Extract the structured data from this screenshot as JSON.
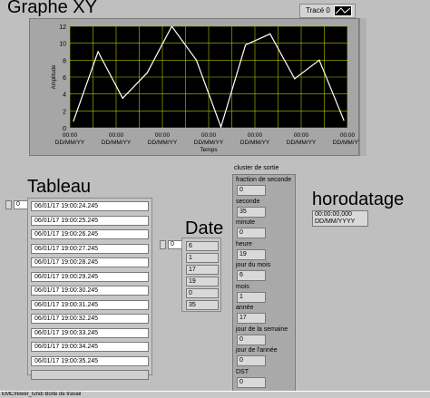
{
  "graph": {
    "title": "Graphe XY",
    "legend_label": "Tracé 0",
    "x_axis_label": "Temps",
    "y_axis_label": "Amplitude",
    "x_tick_time": "00:00",
    "x_tick_date": "DD/MM/YY",
    "plot_bg_color": "#000000",
    "grid_color": "#b5c400",
    "line_color": "#ffffff",
    "y_ticks": [
      "0",
      "2",
      "4",
      "6",
      "8",
      "10",
      "12"
    ]
  },
  "chart_data": {
    "type": "line",
    "xlabel": "Temps",
    "ylabel": "Amplitude",
    "ylim": [
      0,
      12
    ],
    "x": [
      0,
      1,
      2,
      3,
      4,
      5,
      6,
      7,
      8,
      9,
      10,
      11
    ],
    "series": [
      {
        "name": "Tracé 0",
        "values": [
          0.8,
          9,
          3.5,
          6.5,
          12,
          8,
          0.1,
          9.8,
          11.1,
          5.8,
          8,
          0.9
        ]
      }
    ],
    "grid": true,
    "legend": "top-right"
  },
  "table": {
    "title": "Tableau",
    "index": "0",
    "rows": [
      "06/01/17 19:00:24.245",
      "06/01/17 19:00:25.245",
      "06/01/17 19:00:26.245",
      "06/01/17 19:00:27.245",
      "06/01/17 19:00:28.245",
      "06/01/17 19:00:29.245",
      "06/01/17 19:00:30.245",
      "06/01/17 19:00:31.245",
      "06/01/17 19:00:32.245",
      "06/01/17 19:00:33.245",
      "06/01/17 19:00:34.245",
      "06/01/17 19:00:35.245"
    ]
  },
  "date": {
    "title": "Date",
    "index": "0",
    "values": [
      "6",
      "1",
      "17",
      "19",
      "0",
      "35"
    ]
  },
  "cluster": {
    "label": "cluster de sortie",
    "fields": [
      {
        "label": "fraction de seconde",
        "value": "0"
      },
      {
        "label": "seconde",
        "value": "35"
      },
      {
        "label": "minute",
        "value": "0"
      },
      {
        "label": "heure",
        "value": "19"
      },
      {
        "label": "jour du mois",
        "value": "6"
      },
      {
        "label": "mois",
        "value": "1"
      },
      {
        "label": "année",
        "value": "17"
      },
      {
        "label": "jour de la semaine",
        "value": "0"
      },
      {
        "label": "jour de l'année",
        "value": "0"
      },
      {
        "label": "DST",
        "value": "0"
      }
    ]
  },
  "timestamp": {
    "title": "horodatage",
    "line1": "00:00:00,000",
    "line2": "DD/MM/YYYY"
  },
  "taskbar": {
    "text": "EMC\\fewer_lundi Boîte de travail"
  }
}
